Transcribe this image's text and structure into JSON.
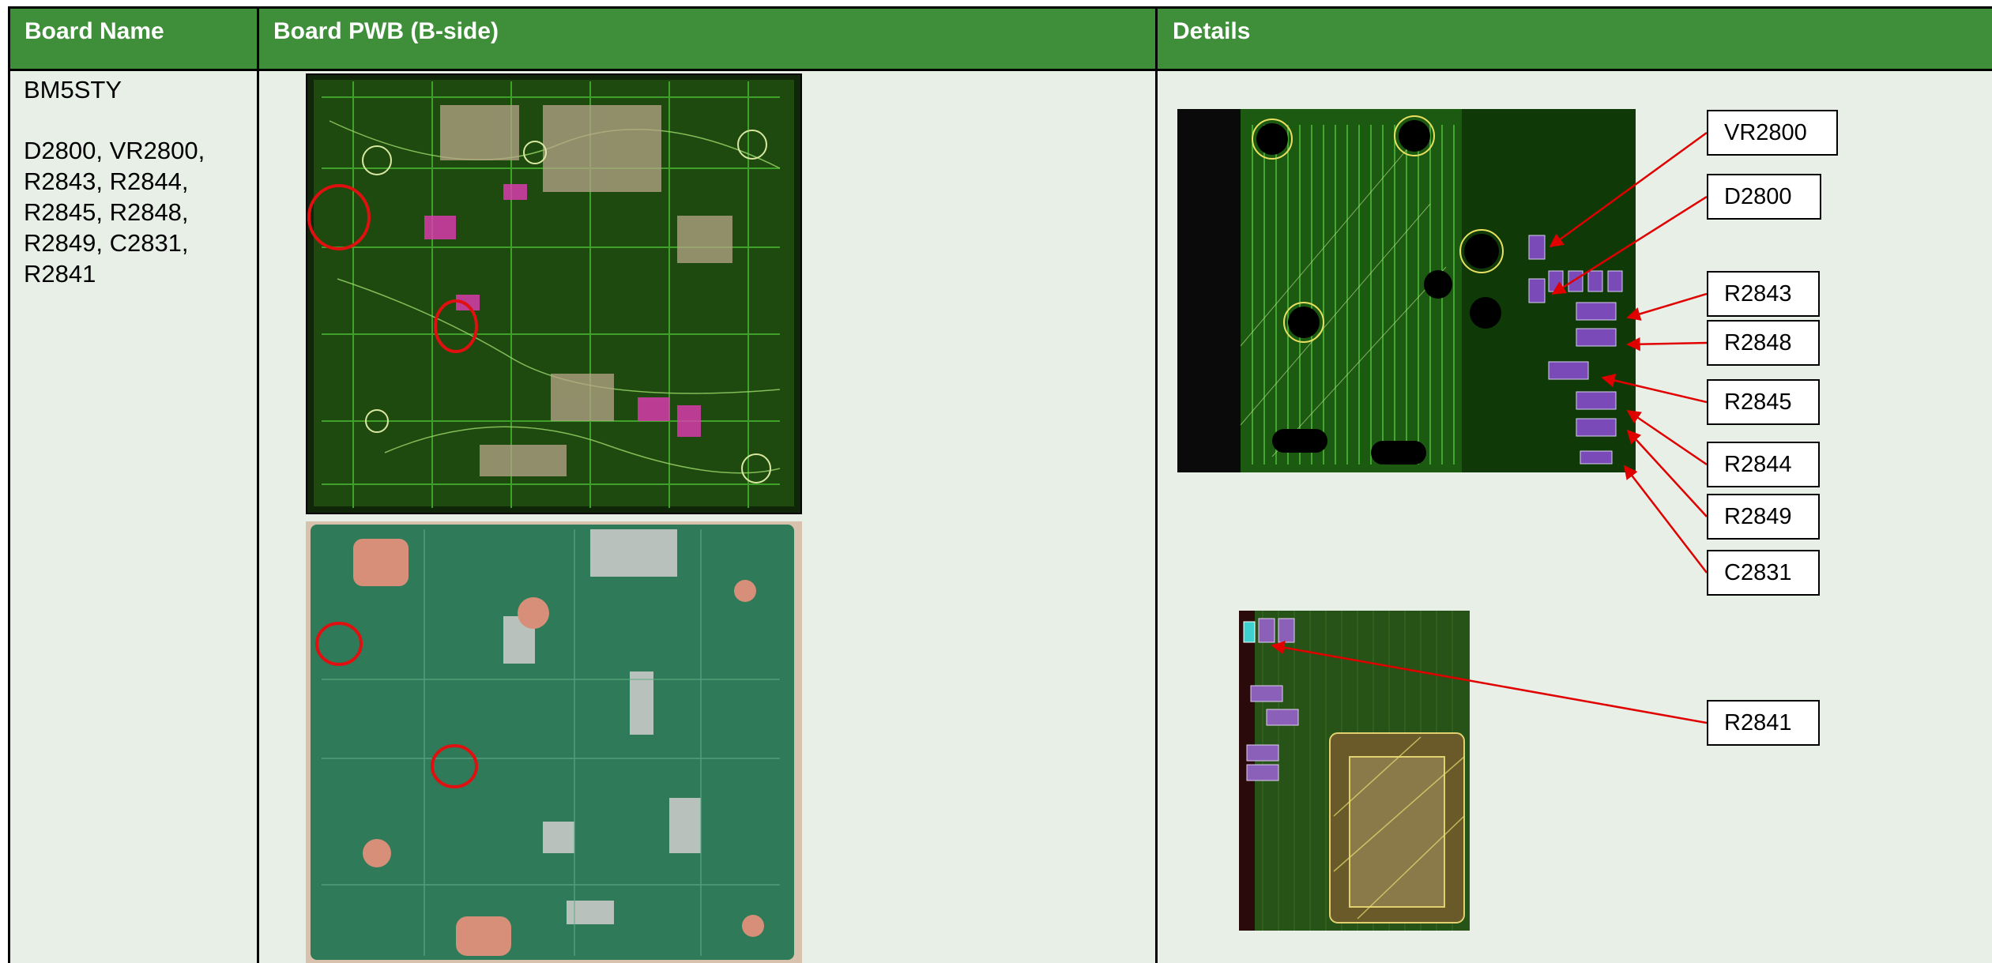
{
  "header": {
    "col1": "Board Name",
    "col2": "Board PWB  (B-side)",
    "col3": "Details"
  },
  "board": {
    "name": "BM5STY",
    "parts_lines": [
      "D2800, VR2800,",
      "R2843, R2844,",
      "R2845, R2848,",
      "R2849, C2831,",
      "R2841"
    ]
  },
  "callouts": [
    "VR2800",
    "D2800",
    "R2843",
    "R2848",
    "R2845",
    "R2844",
    "R2849",
    "C2831",
    "R2841"
  ],
  "colors": {
    "header_green": "#3f8f3a",
    "cell_bg": "#e7efe7",
    "arrow": "#e00000"
  }
}
